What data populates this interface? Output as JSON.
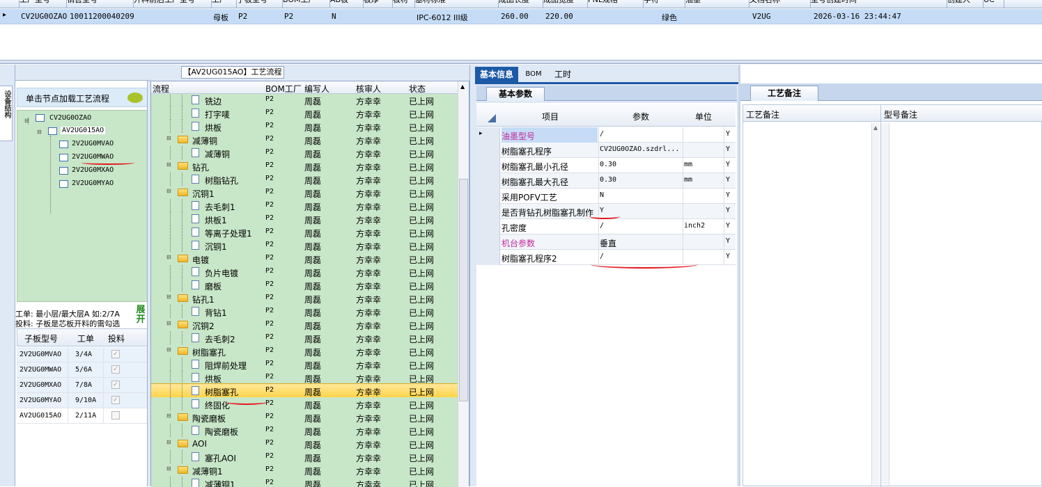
{
  "top": {
    "headers": [
      "工厂型号",
      "销售型号",
      "开料前后工厂型号",
      "工厂",
      "子板型号",
      "BOM工厂",
      "AB板",
      "板厚",
      "板材",
      "基材标准",
      "成品长度",
      "成品宽度",
      "PNL规格",
      "字符",
      "油墨",
      "文档名称",
      "型号创建时间",
      "创建人",
      "UC"
    ],
    "row": {
      "col1": "CV2UG0OZAO",
      "col2": "10011200040209",
      "col3": "母板",
      "col4": "P2",
      "col5": "P2",
      "col6": "N",
      "col7": "IPC-6012 III级",
      "col8": "260.00",
      "col9": "220.00",
      "col10": "绿色",
      "col11": "V2UG",
      "col12": "2026-03-16 23:44:47"
    }
  },
  "left": {
    "side_label": "设备结构",
    "load_button": "单击节点加载工艺流程",
    "tree": [
      "CV2UG0OZAO",
      "AV2UG015AO",
      "2V2UG0MVAO",
      "2V2UG0MWAO",
      "2V2UG0MXAO",
      "2V2UG0MYAO"
    ],
    "info1": "工单: 最小层/最大层A 如:2/7A",
    "info2": "投料: 子板是芯板开料的需勾选",
    "expand_btn": "展开",
    "grid_headers": [
      "子板型号",
      "工单",
      "投料"
    ],
    "grid_rows": [
      {
        "model": "2V2UG0MVAO",
        "order": "3/4A",
        "checked": true
      },
      {
        "model": "2V2UG0MWAO",
        "order": "5/6A",
        "checked": true
      },
      {
        "model": "2V2UG0MXAO",
        "order": "7/8A",
        "checked": true
      },
      {
        "model": "2V2UG0MYAO",
        "order": "9/10A",
        "checked": true
      },
      {
        "model": "AV2UG015AO",
        "order": "2/11A",
        "checked": false
      }
    ]
  },
  "middle": {
    "title": "【AV2UG015AO】工艺流程",
    "headers": [
      "流程",
      "BOM工厂",
      "编写人",
      "核审人",
      "状态"
    ],
    "rows": [
      {
        "name": "铣边",
        "level": 2,
        "folder": false,
        "bom": "P2",
        "writer": "周磊",
        "checker": "方幸幸",
        "status": "已上网"
      },
      {
        "name": "打字唛",
        "level": 2,
        "folder": false,
        "bom": "P2",
        "writer": "周磊",
        "checker": "方幸幸",
        "status": "已上网"
      },
      {
        "name": "烘板",
        "level": 2,
        "folder": false,
        "bom": "P2",
        "writer": "周磊",
        "checker": "方幸幸",
        "status": "已上网"
      },
      {
        "name": "减薄铜",
        "level": 1,
        "folder": true,
        "bom": "P2",
        "writer": "周磊",
        "checker": "方幸幸",
        "status": "已上网"
      },
      {
        "name": "减薄铜",
        "level": 2,
        "folder": false,
        "bom": "P2",
        "writer": "周磊",
        "checker": "方幸幸",
        "status": "已上网"
      },
      {
        "name": "钻孔",
        "level": 1,
        "folder": true,
        "bom": "P2",
        "writer": "周磊",
        "checker": "方幸幸",
        "status": "已上网"
      },
      {
        "name": "树脂钻孔",
        "level": 2,
        "folder": false,
        "bom": "P2",
        "writer": "周磊",
        "checker": "方幸幸",
        "status": "已上网"
      },
      {
        "name": "沉铜1",
        "level": 1,
        "folder": true,
        "bom": "P2",
        "writer": "周磊",
        "checker": "方幸幸",
        "status": "已上网"
      },
      {
        "name": "去毛刺1",
        "level": 2,
        "folder": false,
        "bom": "P2",
        "writer": "周磊",
        "checker": "方幸幸",
        "status": "已上网"
      },
      {
        "name": "烘板1",
        "level": 2,
        "folder": false,
        "bom": "P2",
        "writer": "周磊",
        "checker": "方幸幸",
        "status": "已上网"
      },
      {
        "name": "等离子处理1",
        "level": 2,
        "folder": false,
        "bom": "P2",
        "writer": "周磊",
        "checker": "方幸幸",
        "status": "已上网"
      },
      {
        "name": "沉铜1",
        "level": 2,
        "folder": false,
        "bom": "P2",
        "writer": "周磊",
        "checker": "方幸幸",
        "status": "已上网"
      },
      {
        "name": "电镀",
        "level": 1,
        "folder": true,
        "bom": "P2",
        "writer": "周磊",
        "checker": "方幸幸",
        "status": "已上网"
      },
      {
        "name": "负片电镀",
        "level": 2,
        "folder": false,
        "bom": "P2",
        "writer": "周磊",
        "checker": "方幸幸",
        "status": "已上网"
      },
      {
        "name": "磨板",
        "level": 2,
        "folder": false,
        "bom": "P2",
        "writer": "周磊",
        "checker": "方幸幸",
        "status": "已上网"
      },
      {
        "name": "钻孔1",
        "level": 1,
        "folder": true,
        "bom": "P2",
        "writer": "周磊",
        "checker": "方幸幸",
        "status": "已上网"
      },
      {
        "name": "背钻1",
        "level": 2,
        "folder": false,
        "bom": "P2",
        "writer": "周磊",
        "checker": "方幸幸",
        "status": "已上网"
      },
      {
        "name": "沉铜2",
        "level": 1,
        "folder": true,
        "bom": "P2",
        "writer": "周磊",
        "checker": "方幸幸",
        "status": "已上网"
      },
      {
        "name": "去毛刺2",
        "level": 2,
        "folder": false,
        "bom": "P2",
        "writer": "周磊",
        "checker": "方幸幸",
        "status": "已上网"
      },
      {
        "name": "树脂塞孔",
        "level": 1,
        "folder": true,
        "bom": "P2",
        "writer": "周磊",
        "checker": "方幸幸",
        "status": "已上网"
      },
      {
        "name": "阻焊前处理",
        "level": 2,
        "folder": false,
        "bom": "P2",
        "writer": "周磊",
        "checker": "方幸幸",
        "status": "已上网"
      },
      {
        "name": "烘板",
        "level": 2,
        "folder": false,
        "bom": "P2",
        "writer": "周磊",
        "checker": "方幸幸",
        "status": "已上网"
      },
      {
        "name": "树脂塞孔",
        "level": 2,
        "folder": false,
        "bom": "P2",
        "writer": "周磊",
        "checker": "方幸幸",
        "status": "已上网",
        "selected": true
      },
      {
        "name": "终固化",
        "level": 2,
        "folder": false,
        "bom": "P2",
        "writer": "周磊",
        "checker": "方幸幸",
        "status": "已上网"
      },
      {
        "name": "陶瓷磨板",
        "level": 1,
        "folder": true,
        "bom": "P2",
        "writer": "周磊",
        "checker": "方幸幸",
        "status": "已上网"
      },
      {
        "name": "陶瓷磨板",
        "level": 2,
        "folder": false,
        "bom": "P2",
        "writer": "周磊",
        "checker": "方幸幸",
        "status": "已上网"
      },
      {
        "name": "AOI",
        "level": 1,
        "folder": true,
        "bom": "P2",
        "writer": "周磊",
        "checker": "方幸幸",
        "status": "已上网"
      },
      {
        "name": "塞孔AOI",
        "level": 2,
        "folder": false,
        "bom": "P2",
        "writer": "周磊",
        "checker": "方幸幸",
        "status": "已上网"
      },
      {
        "name": "减薄铜1",
        "level": 1,
        "folder": true,
        "bom": "P2",
        "writer": "周磊",
        "checker": "方幸幸",
        "status": "已上网"
      },
      {
        "name": "减薄铜1",
        "level": 2,
        "folder": false,
        "bom": "P2",
        "writer": "周磊",
        "checker": "方幸幸",
        "status": "已上网"
      }
    ]
  },
  "right": {
    "tabs": [
      "基本信息",
      "BOM",
      "工时"
    ],
    "subtab": "基本参数",
    "headers": [
      "项目",
      "参数",
      "单位"
    ],
    "rows": [
      {
        "item": "油墨型号",
        "param": "/",
        "unit": "",
        "flag": "Y",
        "pink": true
      },
      {
        "item": "树脂塞孔程序",
        "param": "CV2UG0OZAO.szdrl...",
        "unit": "",
        "flag": "Y",
        "pink": false
      },
      {
        "item": "树脂塞孔最小孔径",
        "param": "0.30",
        "unit": "mm",
        "flag": "Y",
        "pink": false
      },
      {
        "item": "树脂塞孔最大孔径",
        "param": "0.30",
        "unit": "mm",
        "flag": "Y",
        "pink": false
      },
      {
        "item": "采用POFV工艺",
        "param": "N",
        "unit": "",
        "flag": "Y",
        "pink": false
      },
      {
        "item": "是否背钻孔树脂塞孔制作",
        "param": "Y",
        "unit": "",
        "flag": "Y",
        "pink": false
      },
      {
        "item": "孔密度",
        "param": "/",
        "unit": "inch2",
        "flag": "Y",
        "pink": false
      },
      {
        "item": "机台参数",
        "param": "垂直",
        "unit": "",
        "flag": "Y",
        "pink": true
      },
      {
        "item": "树脂塞孔程序2",
        "param": "/",
        "unit": "",
        "flag": "Y",
        "pink": false
      }
    ],
    "notes_tab": "工艺备注",
    "notes_headers": [
      "工艺备注",
      "型号备注"
    ]
  },
  "colors": {
    "grid_green": "#c8e6c8",
    "selected_row": "#c6dcf6",
    "tab_blue": "#1c5aa6",
    "pink": "#c02a9a",
    "annotation_red": "#e3191f"
  }
}
